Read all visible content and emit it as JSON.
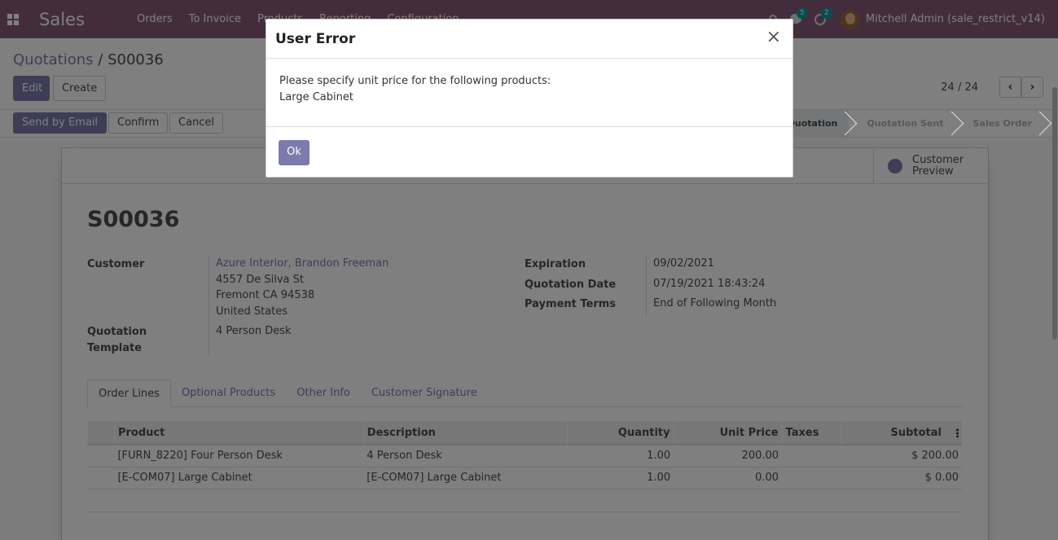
{
  "navbar": {
    "app_name": "Sales",
    "menu": [
      "Orders",
      "To Invoice",
      "Products",
      "Reporting",
      "Configuration"
    ],
    "chat_count": "5",
    "activity_count": "2",
    "user": "Mitchell Admin (sale_restrict_v14)"
  },
  "control_panel": {
    "breadcrumb_parent": "Quotations",
    "breadcrumb_sep": " / ",
    "breadcrumb_current": "S00036",
    "edit_label": "Edit",
    "create_label": "Create",
    "pager": "24 / 24"
  },
  "statusbar": {
    "send_email_label": "Send by Email",
    "confirm_label": "Confirm",
    "cancel_label": "Cancel",
    "stages": [
      "Quotation",
      "Quotation Sent",
      "Sales Order"
    ]
  },
  "sheet": {
    "customer_preview_label": "Customer Preview",
    "title": "S00036",
    "customer_label": "Customer",
    "customer_name": "Azure Interior, Brandon Freeman",
    "customer_address": [
      "4557 De Silva St",
      "Fremont CA 94538",
      "United States"
    ],
    "template_label_1": "Quotation",
    "template_label_2": "Template",
    "template_value": "4 Person Desk",
    "expiration_label": "Expiration",
    "expiration_value": "09/02/2021",
    "quotation_date_label": "Quotation Date",
    "quotation_date_value": "07/19/2021 18:43:24",
    "payment_terms_label": "Payment Terms",
    "payment_terms_value": "End of Following Month",
    "tabs": [
      "Order Lines",
      "Optional Products",
      "Other Info",
      "Customer Signature"
    ]
  },
  "order_lines": {
    "headers": [
      "Product",
      "Description",
      "Quantity",
      "Unit Price",
      "Taxes",
      "Subtotal"
    ],
    "rows": [
      {
        "product": "[FURN_8220] Four Person Desk",
        "description": "4 Person Desk",
        "quantity": "1.00",
        "unit_price": "200.00",
        "taxes": "",
        "subtotal": "$ 200.00"
      },
      {
        "product": "[E-COM07] Large Cabinet",
        "description": "[E-COM07] Large Cabinet",
        "quantity": "1.00",
        "unit_price": "0.00",
        "taxes": "",
        "subtotal": "$ 0.00"
      }
    ]
  },
  "dialog": {
    "title": "User Error",
    "close_symbol": "×",
    "message_line1": "Please specify unit price for the following products:",
    "message_line2": "Large Cabinet",
    "ok_label": "Ok"
  },
  "colors": {
    "brand": "#875A7B",
    "primary": "#7C7BAD",
    "badge": "#00A09D"
  }
}
